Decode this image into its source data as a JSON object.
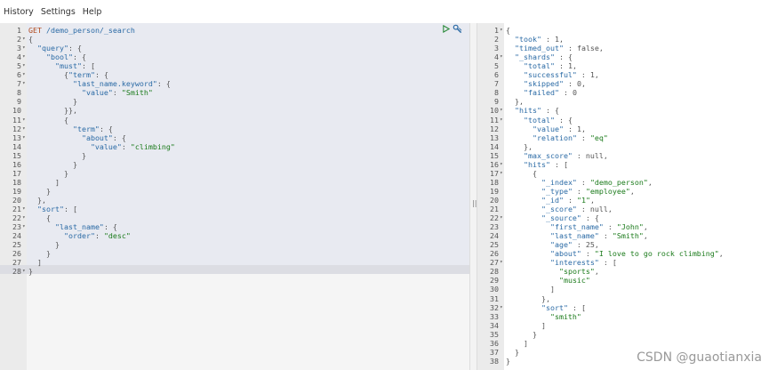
{
  "menu": {
    "items": [
      "History",
      "Settings",
      "Help"
    ]
  },
  "request": {
    "lines": [
      {
        "n": "1",
        "f": "",
        "t": "GET /demo_person/_search"
      },
      {
        "n": "2",
        "f": "▾",
        "t": "{"
      },
      {
        "n": "3",
        "f": "▾",
        "t": "  \"query\": {"
      },
      {
        "n": "4",
        "f": "▾",
        "t": "    \"bool\": {"
      },
      {
        "n": "5",
        "f": "▾",
        "t": "      \"must\": ["
      },
      {
        "n": "6",
        "f": "▾",
        "t": "        {\"term\": {"
      },
      {
        "n": "7",
        "f": "▾",
        "t": "          \"last_name.keyword\": {"
      },
      {
        "n": "8",
        "f": "",
        "t": "            \"value\": \"Smith\""
      },
      {
        "n": "9",
        "f": "",
        "t": "          }"
      },
      {
        "n": "10",
        "f": "",
        "t": "        }},"
      },
      {
        "n": "11",
        "f": "▾",
        "t": "        {"
      },
      {
        "n": "12",
        "f": "▾",
        "t": "          \"term\": {"
      },
      {
        "n": "13",
        "f": "▾",
        "t": "            \"about\": {"
      },
      {
        "n": "14",
        "f": "",
        "t": "              \"value\": \"climbing\""
      },
      {
        "n": "15",
        "f": "",
        "t": "            }"
      },
      {
        "n": "16",
        "f": "",
        "t": "          }"
      },
      {
        "n": "17",
        "f": "",
        "t": "        }"
      },
      {
        "n": "18",
        "f": "",
        "t": "      ]"
      },
      {
        "n": "19",
        "f": "",
        "t": "    }"
      },
      {
        "n": "20",
        "f": "",
        "t": "  },"
      },
      {
        "n": "21",
        "f": "▾",
        "t": "  \"sort\": ["
      },
      {
        "n": "22",
        "f": "▾",
        "t": "    {"
      },
      {
        "n": "23",
        "f": "▾",
        "t": "      \"last_name\": {"
      },
      {
        "n": "24",
        "f": "",
        "t": "        \"order\": \"desc\""
      },
      {
        "n": "25",
        "f": "",
        "t": "      }"
      },
      {
        "n": "26",
        "f": "",
        "t": "    }"
      },
      {
        "n": "27",
        "f": "",
        "t": "  ]"
      },
      {
        "n": "28",
        "f": "▾",
        "t": "}"
      }
    ]
  },
  "response": {
    "lines": [
      {
        "n": "1",
        "f": "▾",
        "t": "{"
      },
      {
        "n": "2",
        "f": "",
        "t": "  \"took\" : 1,"
      },
      {
        "n": "3",
        "f": "",
        "t": "  \"timed_out\" : false,"
      },
      {
        "n": "4",
        "f": "▾",
        "t": "  \"_shards\" : {"
      },
      {
        "n": "5",
        "f": "",
        "t": "    \"total\" : 1,"
      },
      {
        "n": "6",
        "f": "",
        "t": "    \"successful\" : 1,"
      },
      {
        "n": "7",
        "f": "",
        "t": "    \"skipped\" : 0,"
      },
      {
        "n": "8",
        "f": "",
        "t": "    \"failed\" : 0"
      },
      {
        "n": "9",
        "f": "",
        "t": "  },"
      },
      {
        "n": "10",
        "f": "▾",
        "t": "  \"hits\" : {"
      },
      {
        "n": "11",
        "f": "▾",
        "t": "    \"total\" : {"
      },
      {
        "n": "12",
        "f": "",
        "t": "      \"value\" : 1,"
      },
      {
        "n": "13",
        "f": "",
        "t": "      \"relation\" : \"eq\""
      },
      {
        "n": "14",
        "f": "",
        "t": "    },"
      },
      {
        "n": "15",
        "f": "",
        "t": "    \"max_score\" : null,"
      },
      {
        "n": "16",
        "f": "▾",
        "t": "    \"hits\" : ["
      },
      {
        "n": "17",
        "f": "▾",
        "t": "      {"
      },
      {
        "n": "18",
        "f": "",
        "t": "        \"_index\" : \"demo_person\","
      },
      {
        "n": "19",
        "f": "",
        "t": "        \"_type\" : \"employee\","
      },
      {
        "n": "20",
        "f": "",
        "t": "        \"_id\" : \"1\","
      },
      {
        "n": "21",
        "f": "",
        "t": "        \"_score\" : null,"
      },
      {
        "n": "22",
        "f": "▾",
        "t": "        \"_source\" : {"
      },
      {
        "n": "23",
        "f": "",
        "t": "          \"first_name\" : \"John\","
      },
      {
        "n": "24",
        "f": "",
        "t": "          \"last_name\" : \"Smith\","
      },
      {
        "n": "25",
        "f": "",
        "t": "          \"age\" : 25,"
      },
      {
        "n": "26",
        "f": "",
        "t": "          \"about\" : \"I love to go rock climbing\","
      },
      {
        "n": "27",
        "f": "▾",
        "t": "          \"interests\" : ["
      },
      {
        "n": "28",
        "f": "",
        "t": "            \"sports\","
      },
      {
        "n": "29",
        "f": "",
        "t": "            \"music\""
      },
      {
        "n": "30",
        "f": "",
        "t": "          ]"
      },
      {
        "n": "31",
        "f": "",
        "t": "        },"
      },
      {
        "n": "32",
        "f": "▾",
        "t": "        \"sort\" : ["
      },
      {
        "n": "33",
        "f": "",
        "t": "          \"smith\""
      },
      {
        "n": "34",
        "f": "",
        "t": "        ]"
      },
      {
        "n": "35",
        "f": "",
        "t": "      }"
      },
      {
        "n": "36",
        "f": "",
        "t": "    ]"
      },
      {
        "n": "37",
        "f": "",
        "t": "  }"
      },
      {
        "n": "38",
        "f": "",
        "t": "}"
      }
    ]
  },
  "watermark": "CSDN @guaotianxia",
  "icons": {
    "run": "play-icon",
    "settings": "wrench-icon"
  },
  "colors": {
    "key": "#2a6aa5",
    "string": "#1a7a1a",
    "method": "#b14a1d"
  }
}
